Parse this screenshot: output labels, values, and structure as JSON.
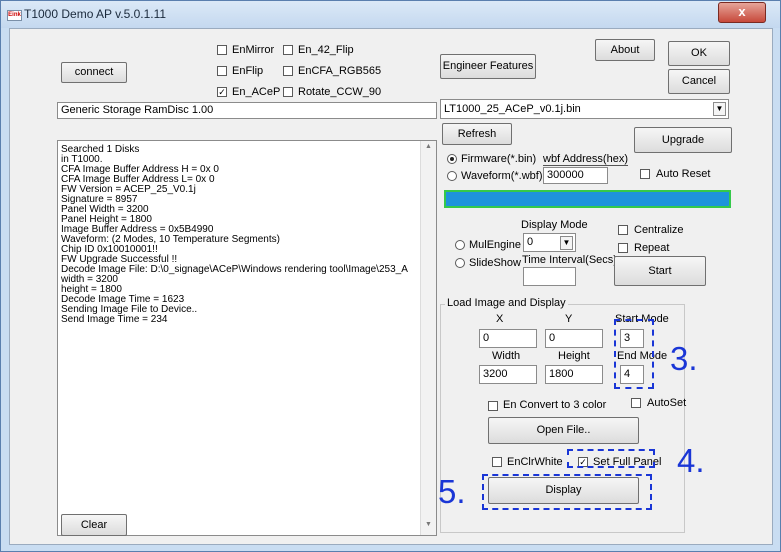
{
  "window": {
    "title": "T1000 Demo AP v.5.0.1.11",
    "app_icon_text": "Eink",
    "close_label": "x"
  },
  "toolbar": {
    "connect_label": "connect",
    "engineer_features_label": "Engineer Features",
    "about_label": "About",
    "ok_label": "OK",
    "cancel_label": "Cancel",
    "refresh_label": "Refresh",
    "upgrade_label": "Upgrade",
    "clear_label": "Clear"
  },
  "options": {
    "en_mirror": {
      "label": "EnMirror",
      "checked": false
    },
    "en_42_flip": {
      "label": "En_42_Flip",
      "checked": false
    },
    "en_flip": {
      "label": "EnFlip",
      "checked": false
    },
    "en_cfa_rgb565": {
      "label": "EnCFA_RGB565",
      "checked": false
    },
    "en_acep": {
      "label": "En_ACeP",
      "checked": true
    },
    "rotate_ccw_90": {
      "label": "Rotate_CCW_90",
      "checked": false
    }
  },
  "device": {
    "storage_name": "Generic Storage RamDisc 1.00",
    "firmware_file": "LT1000_25_ACeP_v0.1j.bin"
  },
  "firmware": {
    "firmware_radio_label": "Firmware(*.bin)",
    "waveform_radio_label": "Waveform(*.wbf)",
    "selected": "firmware",
    "wbf_address_label": "wbf Address(hex)",
    "wbf_address_value": "300000",
    "auto_reset_label": "Auto Reset",
    "progress_fraction": 1.0
  },
  "display_mode": {
    "label": "Display Mode",
    "value": "0",
    "centralize_label": "Centralize",
    "repeat_label": "Repeat",
    "mulengine_label": "MulEngine",
    "slideshow_label": "SlideShow",
    "time_interval_label": "Time Interval(Secs)",
    "time_interval_value": "",
    "start_label": "Start"
  },
  "log": {
    "lines": [
      "Searched 1 Disks",
      "in T1000.",
      "CFA Image Buffer Address H = 0x   0",
      "CFA Image Buffer Address L= 0x   0",
      "FW Version = ACEP_25_V0.1j",
      "Signature = 8957",
      "Panel Width = 3200",
      "Panel Height = 1800",
      "Image Buffer Address = 0x5B4990",
      "Waveform: (2 Modes, 10 Temperature Segments)",
      "Chip ID 0x10010001!!",
      "FW Upgrade Successful !!",
      "Decode Image File: D:\\0_signage\\ACeP\\Windows rendering tool\\Image\\253_A",
      "width = 3200",
      "height = 1800",
      "Decode Image Time = 1623",
      "Sending Image File to Device..",
      "Send Image Time = 234"
    ]
  },
  "load_image": {
    "group_label": "Load Image and Display",
    "x_label": "X",
    "y_label": "Y",
    "x_value": "0",
    "y_value": "0",
    "start_mode_label": "Start Mode",
    "start_mode_value": "3",
    "width_label": "Width",
    "height_label": "Height",
    "width_value": "3200",
    "height_value": "1800",
    "end_mode_label": "End Mode",
    "end_mode_value": "4",
    "en_convert_label": "En Convert to 3 color",
    "autoset_label": "AutoSet",
    "open_file_label": "Open File..",
    "en_clr_white_label": "EnClrWhite",
    "set_full_panel_label": "Set Full Panel",
    "set_full_panel_checked": true,
    "display_label": "Display"
  },
  "annotations": {
    "step3": "3.",
    "step4": "4.",
    "step5": "5."
  },
  "colors": {
    "annotation": "#1a36d6",
    "progress_fill": "#1e93dc",
    "progress_border": "#35c94a"
  }
}
